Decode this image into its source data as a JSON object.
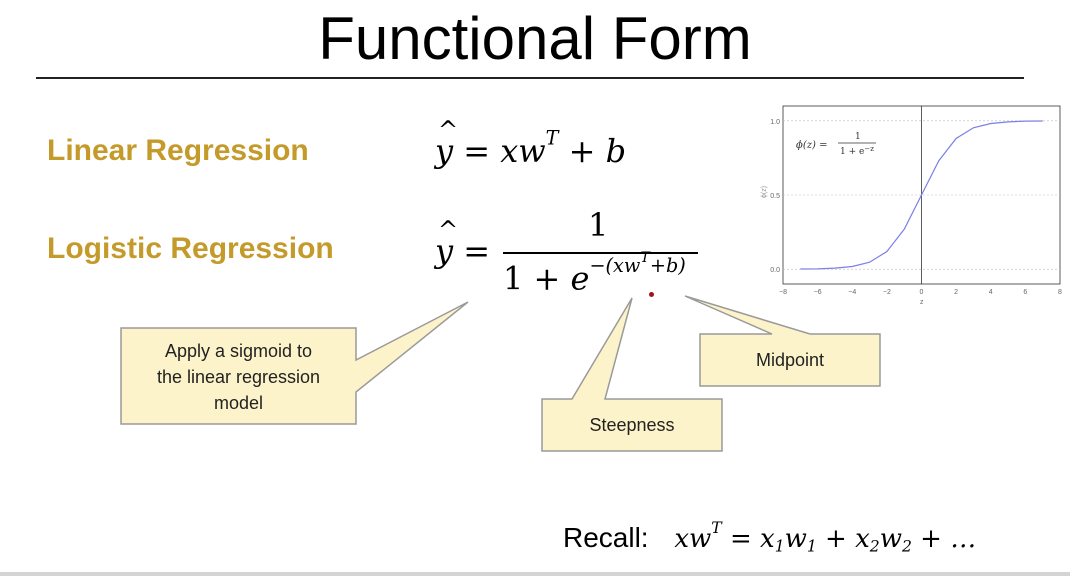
{
  "slide": {
    "title": "Functional Form"
  },
  "rows": {
    "linear_label": "Linear Regression",
    "logistic_label": "Logistic Regression"
  },
  "equations": {
    "linear": {
      "lhs": "y",
      "equals": "=",
      "term": "xw",
      "sup": "T",
      "plus": "+",
      "b": "b"
    },
    "logistic": {
      "lhs": "y",
      "equals": "=",
      "numerator": "1",
      "den_one": "1",
      "den_plus": "+",
      "den_e": "e",
      "exp_prefix": "−(xw",
      "exp_sup": "T",
      "exp_suffix": "+b)"
    }
  },
  "callouts": {
    "sigmoid": [
      "Apply a sigmoid to",
      "the linear regression",
      "model"
    ],
    "steepness": "Steepness",
    "midpoint": "Midpoint"
  },
  "sigmoid_chart": {
    "formula_lhs": "ϕ(z) =",
    "formula_num": "1",
    "formula_den": "1 + e",
    "formula_den_sup": "−z",
    "xlabel": "z",
    "ylabel": "ϕ(z)"
  },
  "chart_data": {
    "type": "line",
    "title": "",
    "xlabel": "z",
    "ylabel": "ϕ(z)",
    "xlim": [
      -8,
      8
    ],
    "ylim": [
      -0.1,
      1.1
    ],
    "x_ticks": [
      "−8",
      "−6",
      "−4",
      "−2",
      "0",
      "2",
      "4",
      "6",
      "8"
    ],
    "y_ticks": [
      "0.0",
      "0.5",
      "1.0"
    ],
    "grid": true,
    "series": [
      {
        "x": [
          -7,
          -6,
          -5,
          -4,
          -3,
          -2,
          -1,
          0,
          1,
          2,
          3,
          4,
          5,
          6,
          7
        ],
        "values": [
          0.001,
          0.002,
          0.007,
          0.018,
          0.047,
          0.119,
          0.269,
          0.5,
          0.731,
          0.881,
          0.953,
          0.982,
          0.993,
          0.998,
          0.999
        ]
      }
    ],
    "color": "#7b7fe6"
  },
  "recall": {
    "label": "Recall:",
    "lhs": "xw",
    "lhs_sup": "T",
    "rhs_1": "= x",
    "rhs_1_sub": "1",
    "rhs_2": "w",
    "rhs_2_sub": "1",
    "rhs_3": " + x",
    "rhs_3_sub": "2",
    "rhs_4": "w",
    "rhs_4_sub": "2",
    "rhs_5": " + …"
  },
  "colors": {
    "label_gold": "#c49a2a",
    "callout_fill": "#fdf3cb",
    "callout_stroke": "#9a9a9a"
  }
}
